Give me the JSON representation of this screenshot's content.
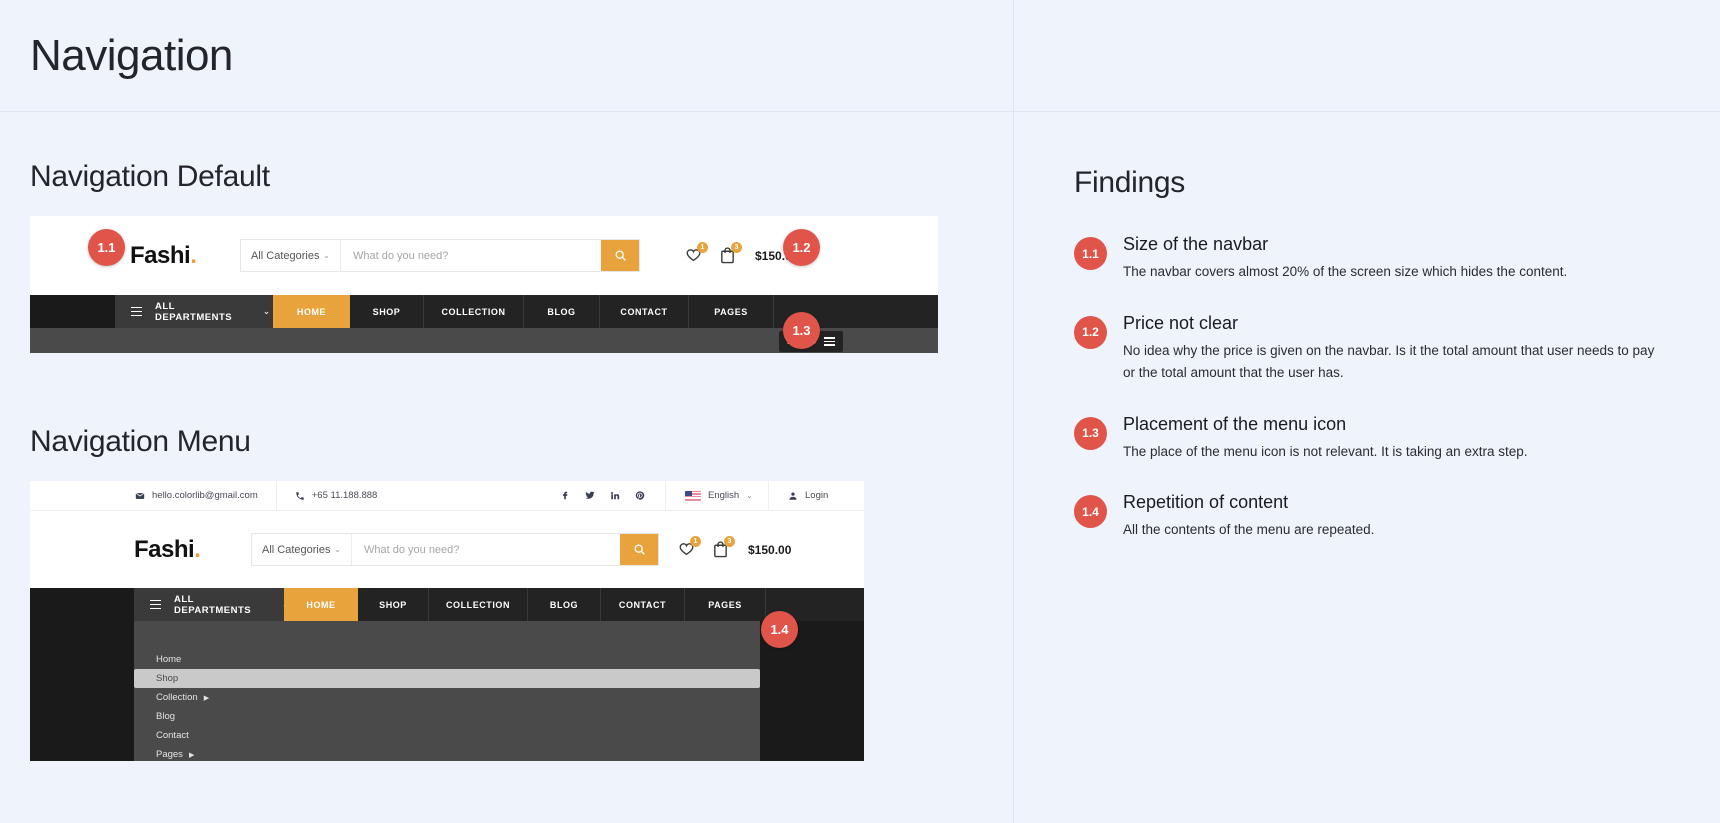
{
  "header": {
    "title": "Navigation"
  },
  "sections": {
    "default_title": "Navigation Default",
    "menu_title": "Navigation Menu"
  },
  "shop_header": {
    "logo": "Fashi",
    "logo_dot": ".",
    "category_select": "All Categories",
    "chevron": "⌄",
    "search_placeholder": "What do you need?",
    "search_icon": "search-icon",
    "wishlist_badge": "1",
    "cart_badge": "3",
    "price": "$150.00"
  },
  "navbar": {
    "departments_label": "ALL DEPARTMENTS",
    "chevron": "⌄",
    "items": [
      {
        "label": "HOME",
        "active": true
      },
      {
        "label": "SHOP",
        "active": false
      },
      {
        "label": "COLLECTION",
        "active": false
      },
      {
        "label": "BLOG",
        "active": false
      },
      {
        "label": "CONTACT",
        "active": false
      },
      {
        "label": "PAGES",
        "active": false
      }
    ],
    "menu_button": "MENU"
  },
  "dropdown": {
    "items": [
      {
        "label": "Home",
        "arrow": "",
        "selected": false
      },
      {
        "label": "Shop",
        "arrow": "",
        "selected": true
      },
      {
        "label": "Collection",
        "arrow": "▶",
        "selected": false
      },
      {
        "label": "Blog",
        "arrow": "",
        "selected": false
      },
      {
        "label": "Contact",
        "arrow": "",
        "selected": false
      },
      {
        "label": "Pages",
        "arrow": "▶",
        "selected": false
      }
    ]
  },
  "utility_bar": {
    "email": "hello.colorlib@gmail.com",
    "phone": "+65 11.188.888",
    "socials": [
      "facebook-icon",
      "twitter-icon",
      "linkedin-icon",
      "pinterest-icon"
    ],
    "language": "English",
    "language_chevron": "⌄",
    "login": "Login"
  },
  "markers": {
    "m11": "1.1",
    "m12": "1.2",
    "m13": "1.3",
    "m14": "1.4"
  },
  "findings": {
    "title": "Findings",
    "items": [
      {
        "num": "1.1",
        "title": "Size of the navbar",
        "desc": "The navbar covers almost 20% of the screen size which hides the content."
      },
      {
        "num": "1.2",
        "title": "Price not clear",
        "desc": "No idea why the price is given on the navbar. Is it the total amount that user needs to pay or the total amount that the user has."
      },
      {
        "num": "1.3",
        "title": "Placement of the menu icon",
        "desc": "The place of the menu icon is not relevant. It is taking an extra step."
      },
      {
        "num": "1.4",
        "title": "Repetition of content",
        "desc": "All the contents of the menu are repeated."
      }
    ]
  },
  "colors": {
    "accent_gold": "#e8a33d",
    "marker_red": "#e0544a",
    "nav_dark": "#232323",
    "nav_mid": "#4a4a4a",
    "page_bg": "#eef3fc"
  }
}
